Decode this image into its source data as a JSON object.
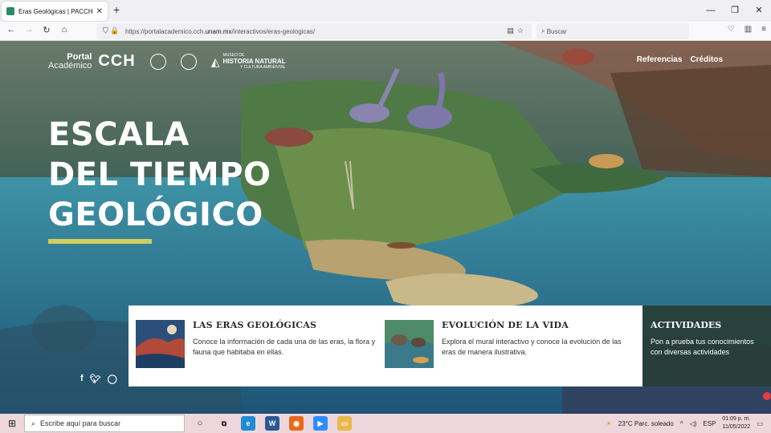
{
  "browser": {
    "tab_title": "Eras Geológicas | PACCH",
    "url_prefix": "https://portalacademico.cch.",
    "url_domain": "unam.mx",
    "url_path": "/interactivos/eras-geologicas/",
    "search_placeholder": "Buscar"
  },
  "site": {
    "portal_line1": "Portal",
    "portal_line2": "Académico",
    "cch_logo": "CCH",
    "museo_small": "MUSEO DE",
    "museo_big": "HISTORIA NATURAL",
    "museo_sub": "Y CULTURA AMBIENTAL",
    "nav": [
      "Referencias",
      "Créditos"
    ]
  },
  "hero": {
    "title_lines": [
      "ESCALA",
      "DEL TIEMPO",
      "GEOLÓGICO"
    ],
    "accent_color": "#cfcf5e"
  },
  "cards": [
    {
      "title": "LAS ERAS GEOLÓGICAS",
      "text": "Conoce la información de cada una de las eras, la flora y fauna que habitaba en ellas."
    },
    {
      "title": "EVOLUCIÓN DE LA VIDA",
      "text": "Explora el mural interactivo y conoce la evolución de las eras de manera ilustrativa."
    }
  ],
  "activities": {
    "title": "ACTIVIDADES",
    "text": "Pon a prueba tus conocimientos con diversas actividades"
  },
  "taskbar": {
    "search_placeholder": "Escribe aquí para buscar",
    "weather": "23°C  Parc. soleado",
    "lang": "ESP",
    "time": "01:09 p. m.",
    "date": "11/05/2022"
  },
  "icons": [
    "window-icon",
    "search-icon",
    "taskview-icon",
    "edge-icon",
    "word-icon",
    "firefox-icon",
    "zoom-icon",
    "folder-icon"
  ]
}
